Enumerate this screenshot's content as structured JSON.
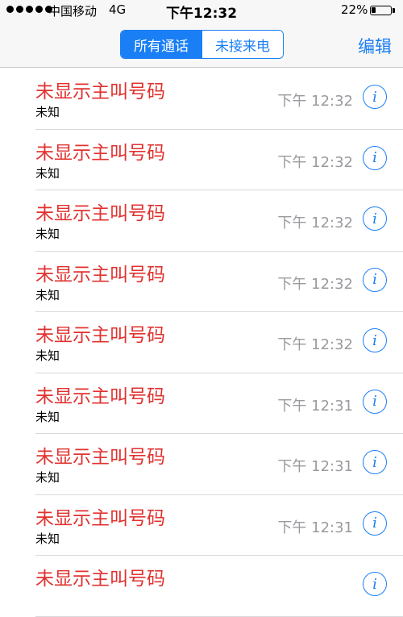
{
  "status_bar": {
    "carrier": "中国移动",
    "network": "4G",
    "time": "下午12:32",
    "battery_percent": "22%",
    "battery_level": 0.22
  },
  "nav": {
    "tabs": [
      {
        "label": "所有通话",
        "active": true
      },
      {
        "label": "未接来电",
        "active": false
      }
    ],
    "edit_label": "编辑"
  },
  "calls": [
    {
      "name": "未显示主叫号码",
      "type": "未知",
      "time": "下午 12:32"
    },
    {
      "name": "未显示主叫号码",
      "type": "未知",
      "time": "下午 12:32"
    },
    {
      "name": "未显示主叫号码",
      "type": "未知",
      "time": "下午 12:32"
    },
    {
      "name": "未显示主叫号码",
      "type": "未知",
      "time": "下午 12:32"
    },
    {
      "name": "未显示主叫号码",
      "type": "未知",
      "time": "下午 12:32"
    },
    {
      "name": "未显示主叫号码",
      "type": "未知",
      "time": "下午 12:31"
    },
    {
      "name": "未显示主叫号码",
      "type": "未知",
      "time": "下午 12:31"
    },
    {
      "name": "未显示主叫号码",
      "type": "未知",
      "time": "下午 12:31"
    },
    {
      "name": "未显示主叫号码",
      "type": "",
      "time": ""
    }
  ],
  "info_icon": "info-icon",
  "colors": {
    "accent": "#1a7ff5",
    "missed_call_red": "#e0322f",
    "time_gray": "#9a9a9f"
  }
}
